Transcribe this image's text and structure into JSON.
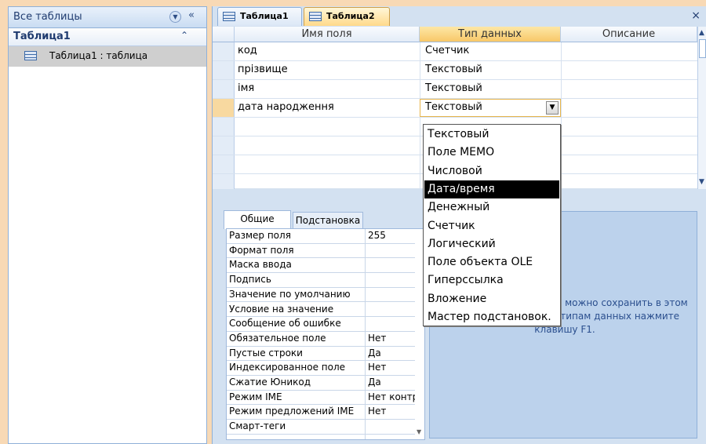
{
  "nav": {
    "title": "Все таблицы",
    "group": "Таблица1",
    "item": "Таблица1 : таблица"
  },
  "tabs": [
    {
      "label": "Таблица1"
    },
    {
      "label": "Таблица2"
    }
  ],
  "close_label": "×",
  "grid": {
    "headers": {
      "field_name": "Имя поля",
      "data_type": "Тип данных",
      "description": "Описание"
    },
    "rows": [
      {
        "name": "код",
        "type": "Счетчик"
      },
      {
        "name": "прізвище",
        "type": "Текстовый"
      },
      {
        "name": "імя",
        "type": "Текстовый"
      },
      {
        "name": "дата народження",
        "type": "Текстовый"
      }
    ]
  },
  "dropdown": {
    "options": [
      "Текстовый",
      "Поле MEMO",
      "Числовой",
      "Дата/время",
      "Денежный",
      "Счетчик",
      "Логический",
      "Поле объекта OLE",
      "Гиперссылка",
      "Вложение",
      "Мастер подстановок."
    ],
    "highlighted": "Дата/время"
  },
  "props": {
    "tabs": [
      "Общие",
      "Подстановка"
    ],
    "rows": [
      {
        "name": "Размер поля",
        "value": "255"
      },
      {
        "name": "Формат поля",
        "value": ""
      },
      {
        "name": "Маска ввода",
        "value": ""
      },
      {
        "name": "Подпись",
        "value": ""
      },
      {
        "name": "Значение по умолчанию",
        "value": ""
      },
      {
        "name": "Условие на значение",
        "value": ""
      },
      {
        "name": "Сообщение об ошибке",
        "value": ""
      },
      {
        "name": "Обязательное поле",
        "value": "Нет"
      },
      {
        "name": "Пустые строки",
        "value": "Да"
      },
      {
        "name": "Индексированное поле",
        "value": "Нет"
      },
      {
        "name": "Сжатие Юникод",
        "value": "Да"
      },
      {
        "name": "Режим IME",
        "value": "Нет контр"
      },
      {
        "name": "Режим предложений IME",
        "value": "Нет"
      },
      {
        "name": "Смарт-теги",
        "value": ""
      }
    ],
    "help_text": "ляет значения, которые можно сохранить в этом поле. Для справки по типам данных нажмите клавишу F1."
  },
  "colors": {
    "accent": "#f8c868",
    "highlight": "#000000",
    "panel": "#d3e1f1"
  }
}
